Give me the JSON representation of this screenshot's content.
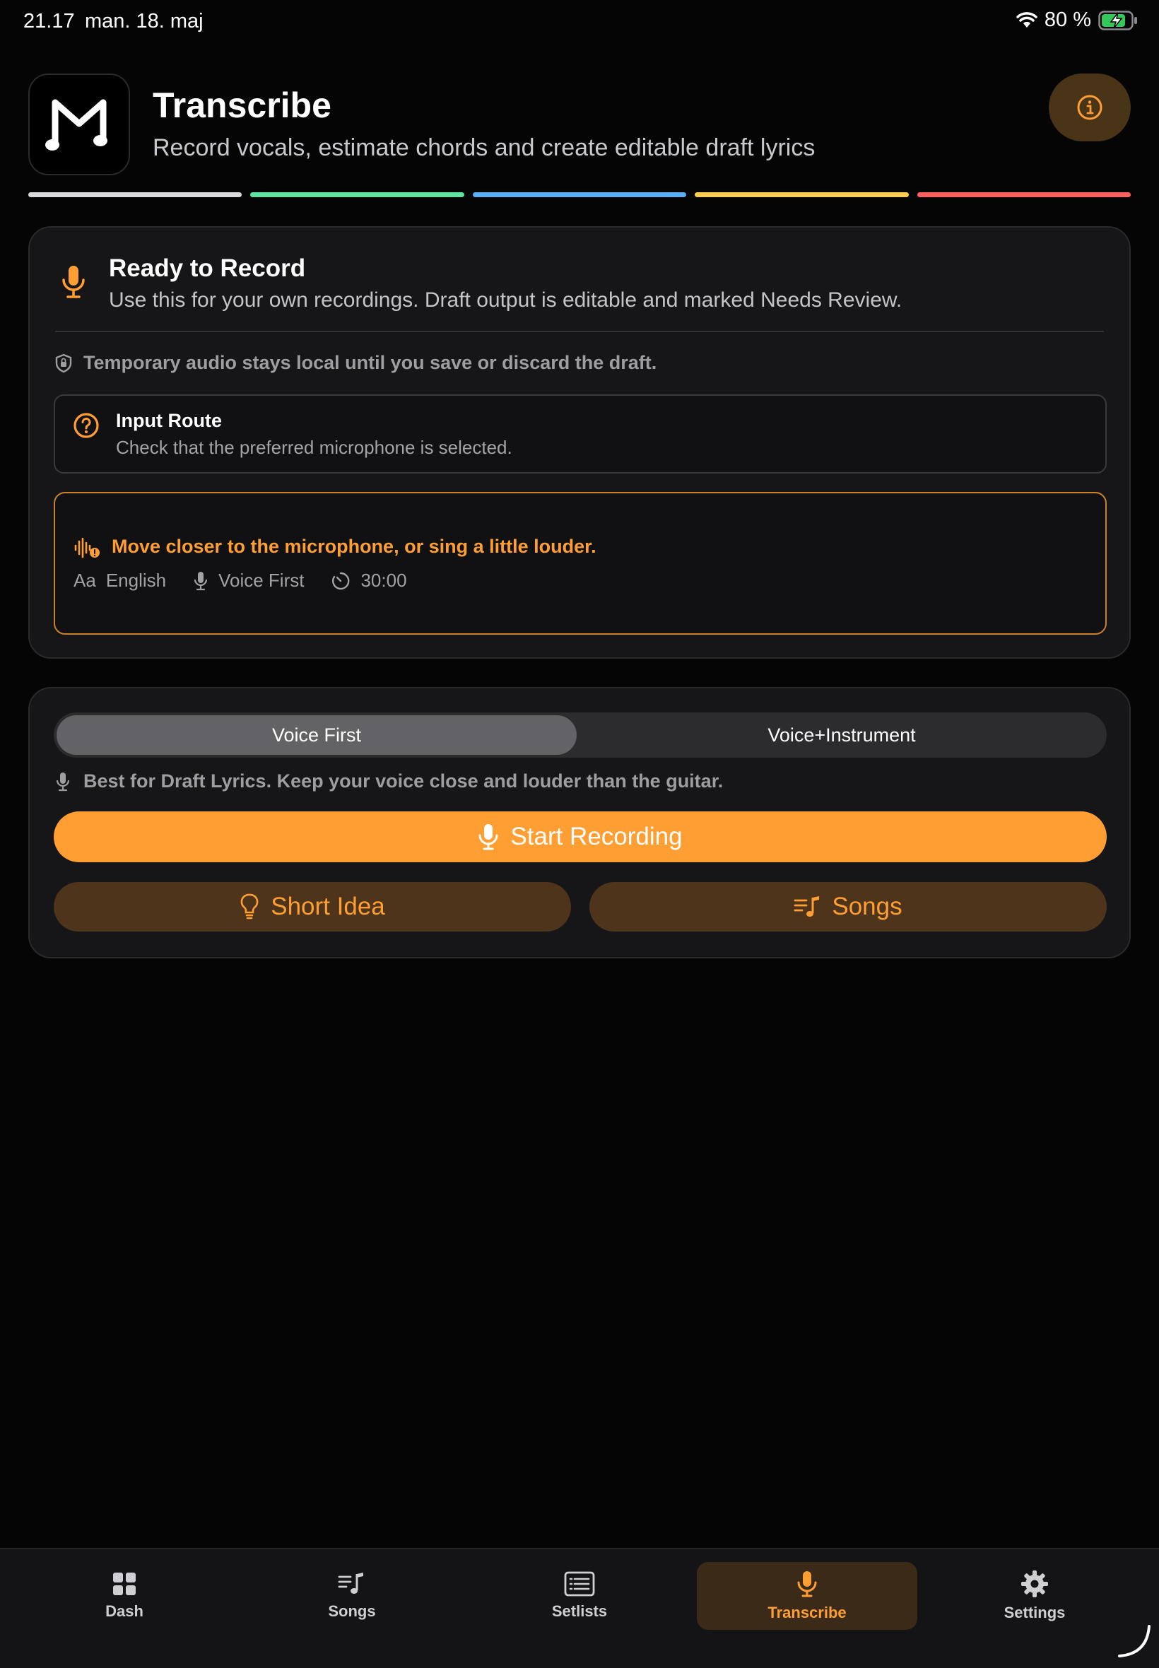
{
  "status_bar": {
    "time": "21.17",
    "date": "man. 18. maj",
    "battery": "80 %"
  },
  "header": {
    "title": "Transcribe",
    "subtitle": "Record vocals, estimate chords and create editable draft lyrics",
    "logo_icon": "music-note-m-logo",
    "info_icon": "info-icon"
  },
  "color_bars": [
    "#d9d9dc",
    "#5fe3a0",
    "#5aaef5",
    "#ffcc4d",
    "#ff5f5f"
  ],
  "status_card": {
    "title": "Ready to Record",
    "description": "Use this for your own recordings. Draft output is editable and marked Needs Review.",
    "privacy_note": "Temporary audio stays local until you save or discard the draft.",
    "input_route": {
      "title": "Input Route",
      "description": "Check that the preferred microphone is selected."
    },
    "warning": {
      "text": "Move closer to the microphone, or sing a little louder.",
      "language_icon_text": "Aa",
      "language": "English",
      "mode": "Voice First",
      "duration": "30:00"
    }
  },
  "record_card": {
    "segments": [
      "Voice First",
      "Voice+Instrument"
    ],
    "selected_segment": "Voice First",
    "hint": "Best for Draft Lyrics. Keep your voice close and louder than the guitar.",
    "start_button": "Start Recording",
    "short_idea_button": "Short Idea",
    "songs_button": "Songs"
  },
  "tabbar": {
    "items": [
      {
        "label": "Dash",
        "icon": "grid-icon"
      },
      {
        "label": "Songs",
        "icon": "music-list-icon"
      },
      {
        "label": "Setlists",
        "icon": "list-box-icon"
      },
      {
        "label": "Transcribe",
        "icon": "microphone-icon"
      },
      {
        "label": "Settings",
        "icon": "gear-icon"
      }
    ],
    "active": "Transcribe"
  },
  "colors": {
    "accent": "#ff9f33",
    "accent_dark": "#4d341b",
    "background": "#050506",
    "card": "#161618"
  }
}
